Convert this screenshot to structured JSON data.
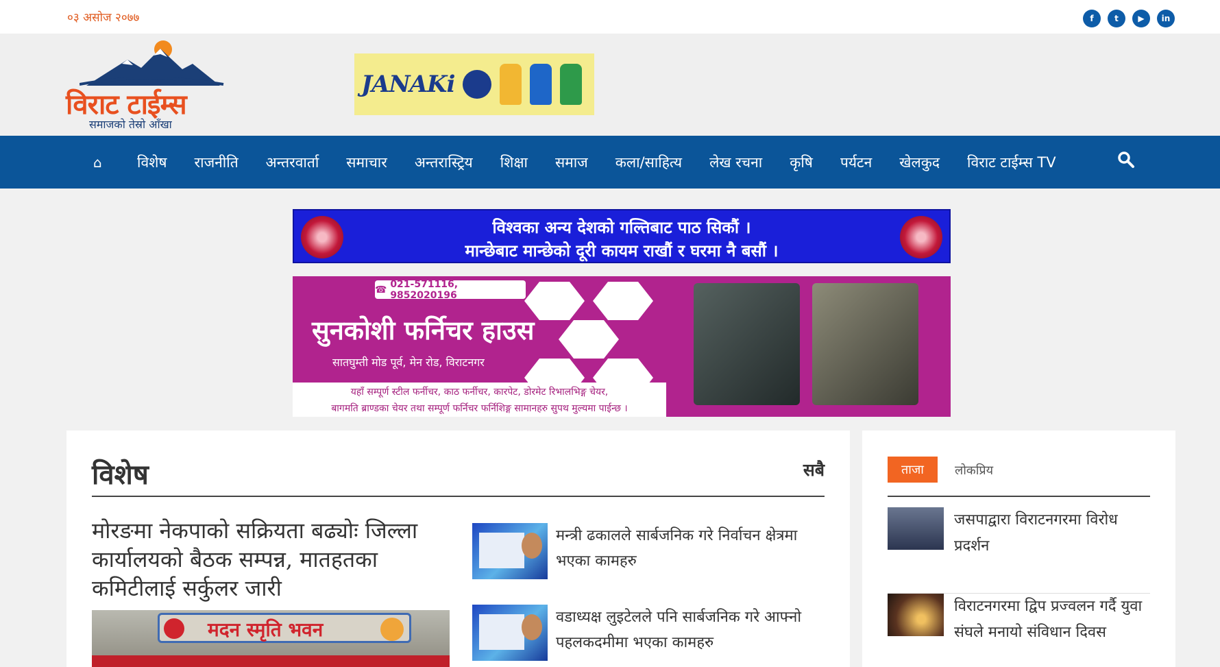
{
  "topbar": {
    "date": "०३ असोज २०७७",
    "social": [
      {
        "icon": "facebook-icon",
        "glyph": "f"
      },
      {
        "icon": "twitter-icon",
        "glyph": "t"
      },
      {
        "icon": "youtube-icon",
        "glyph": "▶"
      },
      {
        "icon": "linkedin-icon",
        "glyph": "in"
      }
    ]
  },
  "header": {
    "logo_text": "विराट टाईम्स",
    "logo_tagline": "समाजको तेस्रो आँखा",
    "ad_brand": "JANAKi"
  },
  "nav": {
    "items": [
      "विशेष",
      "राजनीति",
      "अन्तरवार्ता",
      "समाचार",
      "अन्तरास्ट्रिय",
      "शिक्षा",
      "समाज",
      "कला/साहित्य",
      "लेख रचना",
      "कृषि",
      "पर्यटन",
      "खेलकुद",
      "विराट टाईम्स TV"
    ]
  },
  "banner_covid": {
    "line1": "विश्वका अन्य देशको गल्तिबाट पाठ सिकौं ।",
    "line2": "मान्छेबाट मान्छेको दूरी कायम राखौं र घरमा नै बसौं ।"
  },
  "banner_furniture": {
    "phone": "021-571116, 9852020196",
    "name": "सुनकोशी फर्निचर हाउस",
    "address": "सातघुम्ती मोड पूर्व, मेन रोड, विराटनगर",
    "footer_line1": "यहाँ सम्पूर्ण स्टील फर्नीचर, काठ फर्नीचर, कारपेट, डोरमेट रिभालभिङ्ग चेयर,",
    "footer_line2": "बागमति ब्राण्डका चेयर तथा सम्पूर्ण फर्निचर फर्निशिङ्ग सामानहरु सुपथ मुल्यमा पाईन्छ ।"
  },
  "section": {
    "title": "विशेष",
    "more": "सबै",
    "lead_title": "मोरङमा नेकपाको सक्रियता बढ्योः जिल्ला कार्यालयको बैठक सम्पन्न, मातहतका कमिटीलाई सर्कुलर जारी",
    "lead_image_text": "मदन स्मृति भवन",
    "side": [
      {
        "title": "मन्त्री ढकालले सार्बजनिक गरे निर्वाचन क्षेत्रमा भएका कामहरु"
      },
      {
        "title": "वडाध्यक्ष लुइटेलले पनि सार्बजनिक गरे आफ्नो पहलकदमीमा भएका कामहरु"
      }
    ]
  },
  "aside": {
    "tab_active": "ताजा",
    "tab_inactive": "लोकप्रिय",
    "news": [
      {
        "title": "जसपाद्वारा विराटनगरमा विरोध प्रदर्शन"
      },
      {
        "title": "विराटनगरमा द्विप प्रज्वलन गर्दै युवा संघले मनायो संविधान दिवस"
      }
    ]
  },
  "colors": {
    "nav": "#0b5599",
    "accent": "#f26522",
    "date": "#e05a1e"
  }
}
